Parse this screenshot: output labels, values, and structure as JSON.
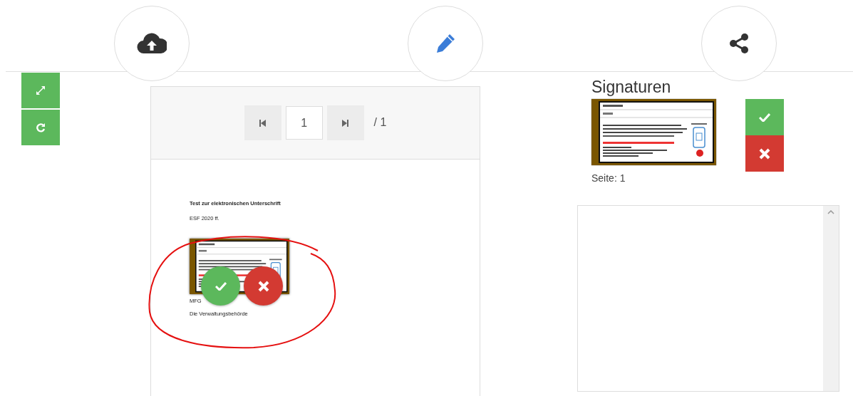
{
  "viewer": {
    "page_input": "1",
    "page_total": "/ 1",
    "document": {
      "title": "Test zur elektronischen Unterschrift",
      "reference": "ESF 2020 ff.",
      "closing": "MFG",
      "sender": "Die Verwaltungsbehörde"
    }
  },
  "signatures": {
    "heading": "Signaturen",
    "page_label": "Seite: 1"
  }
}
